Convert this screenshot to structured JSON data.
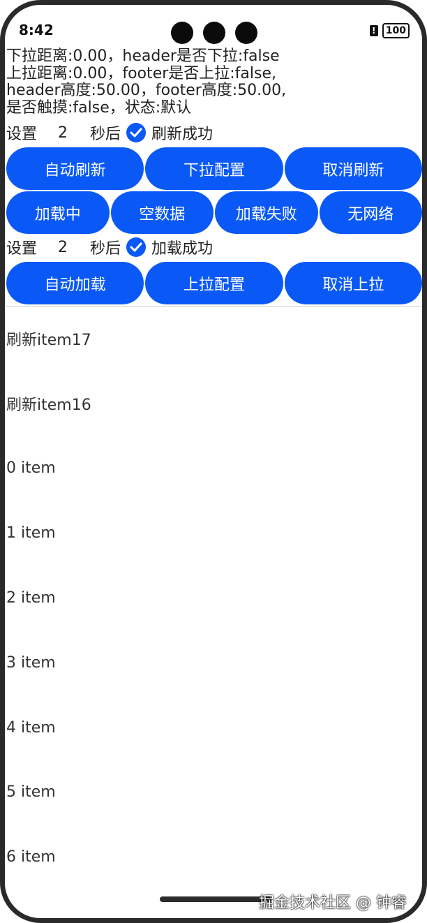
{
  "status": {
    "time": "8:42",
    "battery": "100",
    "alert": "!"
  },
  "info": {
    "line1": "下拉距离:0.00，header是否下拉:false",
    "line2": "上拉距离:0.00，footer是否上拉:false,",
    "line3": "header高度:50.00，footer高度:50.00,",
    "line4": "是否触摸:false，状态:默认"
  },
  "refresh_setting": {
    "label": "设置",
    "seconds": "2",
    "after": "秒后",
    "result": "刷新成功"
  },
  "refresh_buttons": [
    "自动刷新",
    "下拉配置",
    "取消刷新"
  ],
  "state_buttons": [
    "加载中",
    "空数据",
    "加载失败",
    "无网络"
  ],
  "load_setting": {
    "label": "设置",
    "seconds": "2",
    "after": "秒后",
    "result": "加载成功"
  },
  "load_buttons": [
    "自动加载",
    "上拉配置",
    "取消上拉"
  ],
  "list_items": [
    "刷新item17",
    "刷新item16",
    "0 item",
    "1 item",
    "2 item",
    "3 item",
    "4 item",
    "5 item",
    "6 item"
  ],
  "watermark": "掘金技术社区 @ 钟睿",
  "colors": {
    "accent": "#0a59f7"
  }
}
